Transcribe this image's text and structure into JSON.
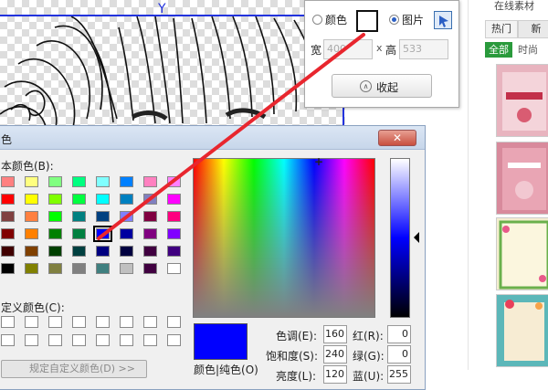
{
  "right_panel": {
    "title": "在线素材",
    "tab_hot": "热门",
    "tab_new": "新",
    "filter_all": "全部",
    "filter_time": "时尚"
  },
  "bg_popup": {
    "color_label": "颜色",
    "image_label": "图片",
    "width_label": "宽",
    "width_value": "400",
    "by": "x",
    "height_label": "高",
    "height_value": "533",
    "collapse_icon": "∧",
    "collapse_label": "收起"
  },
  "dialog": {
    "title": "色",
    "close_symbol": "✕",
    "basic_colors_label": "本颜色(B):",
    "custom_colors_label": "定义颜色(C):",
    "define_custom_button": "规定自定义颜色(D) >>",
    "preview_label": "颜色|纯色(O)",
    "hue_label": "色调(E):",
    "hue_value": "160",
    "sat_label": "饱和度(S):",
    "sat_value": "240",
    "lum_label": "亮度(L):",
    "lum_value": "120",
    "red_label": "红(R):",
    "red_value": "0",
    "green_label": "绿(G):",
    "green_value": "0",
    "blue_label": "蓝(U):",
    "blue_value": "255",
    "selected_color": "#0000ff",
    "basic_colors": [
      "#ff8080",
      "#ffff80",
      "#80ff80",
      "#00ff80",
      "#80ffff",
      "#0080ff",
      "#ff80c0",
      "#ff80ff",
      "#ff0000",
      "#ffff00",
      "#80ff00",
      "#00ff40",
      "#00ffff",
      "#0080c0",
      "#8080c0",
      "#ff00ff",
      "#804040",
      "#ff8040",
      "#00ff00",
      "#008080",
      "#004080",
      "#8080ff",
      "#800040",
      "#ff0080",
      "#800000",
      "#ff8000",
      "#008000",
      "#008040",
      "#0000ff",
      "#0000a0",
      "#800080",
      "#8000ff",
      "#400000",
      "#804000",
      "#004000",
      "#004040",
      "#000080",
      "#000040",
      "#400040",
      "#400080",
      "#000000",
      "#808000",
      "#808040",
      "#808080",
      "#408080",
      "#c0c0c0",
      "#400040",
      "#ffffff"
    ],
    "custom_colors": [
      "#ffffff",
      "#ffffff",
      "#ffffff",
      "#ffffff",
      "#ffffff",
      "#ffffff",
      "#ffffff",
      "#ffffff",
      "#ffffff",
      "#ffffff",
      "#ffffff",
      "#ffffff",
      "#ffffff",
      "#ffffff",
      "#ffffff",
      "#ffffff"
    ]
  },
  "annotation_color": "#e8262e"
}
